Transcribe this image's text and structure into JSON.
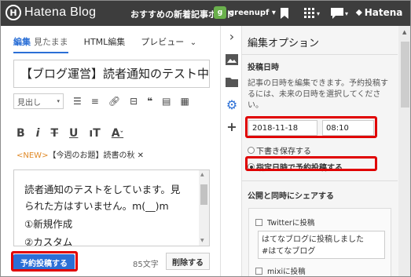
{
  "topbar": {
    "logo_mark": "H",
    "logo_text": "Hatena Blog",
    "recommend": "おすすめの新着記事ボード",
    "user_avatar": "g",
    "user_name": "greenupf ▾",
    "icons": [
      "bookmark-icon",
      "apps-grid-icon",
      "comment-icon"
    ],
    "hatena_label": "Hatena"
  },
  "editor": {
    "tab_edit": "編集",
    "tab_edit_sub": "見たまま",
    "tab_html": "HTML編集",
    "tab_preview": "プレビュー",
    "title": "【ブログ運営】読者通知のテスト中",
    "heading_select": "見出し",
    "category_new": "<NEW>",
    "category_text": "【今週のお題】読書の秋 ✕",
    "body_lines": [
      "読者通知のテストをしています。見",
      "られた方はすいません。m(__)m",
      "①新規作成",
      "②カスタム"
    ],
    "publish_label": "予約投稿する",
    "char_count": "85文字",
    "delete_label": "削除する"
  },
  "options": {
    "title": "編集オプション",
    "post_date_header": "投稿日時",
    "description": "記事の日時を編集できます。予約投稿するには、未来の日時を選択してください。",
    "date_value": "2018-11-18",
    "time_value": "08:10",
    "radio_draft": "下書き保存する",
    "radio_scheduled": "指定日時で予約投稿する",
    "share_header": "公開と同時にシェアする",
    "twitter_label": "Twitterに投稿",
    "share_text_line1": "はてなブログに投稿しました",
    "share_text_line2": "#はてなブログ",
    "mixi_label": "mixiに投稿"
  }
}
